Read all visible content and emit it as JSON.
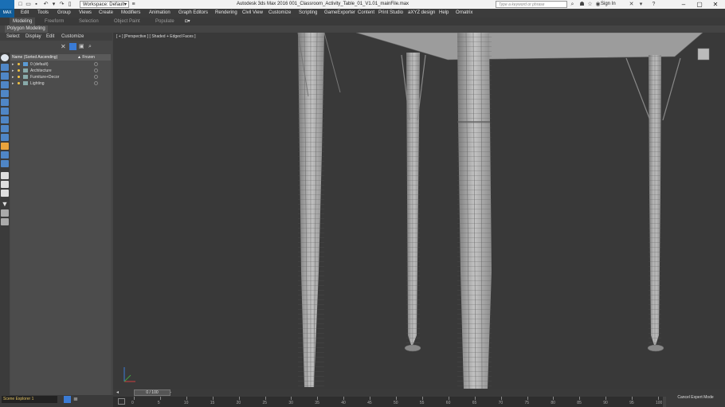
{
  "titlebar": {
    "workspace": "Workspace: Default",
    "app_title": "Autodesk 3ds Max 2016     001_Classroom_Activity_Table_01_V1.01_mainFile.max",
    "search_placeholder": "Type a keyword or phrase",
    "sign_in": "Sign In",
    "controls": {
      "minimize": "–",
      "maximize": "▢",
      "close": "✕"
    }
  },
  "menubar": {
    "logo": "MAX",
    "items": [
      "Edit",
      "Tools",
      "Group",
      "Views",
      "Create",
      "Modifiers",
      "Animation",
      "Graph Editors",
      "Rendering",
      "Civil View",
      "Customize",
      "Scripting",
      "GameExporter",
      "Content",
      "Print Studio",
      "aXYZ design",
      "Help",
      "Ornatrix"
    ]
  },
  "ribbon": {
    "tabs": [
      "Modeling",
      "Freeform",
      "Selection",
      "Object Paint",
      "Populate"
    ],
    "active_tab": "Modeling",
    "sub_label": "Polygon Modeling"
  },
  "explorer": {
    "tabs": [
      "Select",
      "Display",
      "Edit",
      "Customize"
    ],
    "column_name": "Name (Sorted Ascending)",
    "column_frozen": "▲ Frozen",
    "rows": [
      {
        "name": "0 (default)"
      },
      {
        "name": "Architecture"
      },
      {
        "name": "Furniture+Decor"
      },
      {
        "name": "Lighting"
      }
    ],
    "footer": "Scene Explorer 1"
  },
  "viewport": {
    "label": "[ + ] [Perspective ] [ Shaded + Edged Faces ]"
  },
  "timeline": {
    "slider": "0 / 100",
    "ticks": [
      "0",
      "5",
      "10",
      "15",
      "20",
      "25",
      "30",
      "35",
      "40",
      "45",
      "50",
      "55",
      "60",
      "65",
      "70",
      "75",
      "80",
      "85",
      "90",
      "95",
      "100"
    ]
  },
  "status": {
    "cancel": "Cancel Expert Mode"
  },
  "colors": {
    "viewport_bg": "#393939",
    "ui_dark": "#3c3c3c",
    "accent_blue": "#1a6fb5",
    "light_bulb": "#f5c542"
  }
}
